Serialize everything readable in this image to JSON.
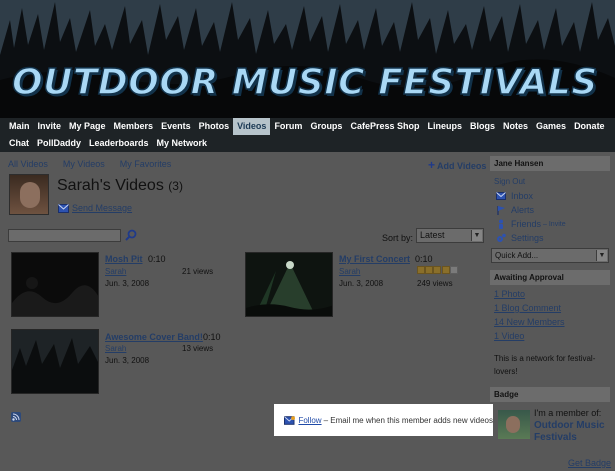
{
  "header": {
    "site_title": "OUTDOOR MUSIC FESTIVALS"
  },
  "nav": {
    "row1": [
      "Main",
      "Invite",
      "My Page",
      "Members",
      "Events",
      "Photos",
      "Videos",
      "Forum",
      "Groups",
      "CafePress Shop",
      "Lineups",
      "Blogs",
      "Notes",
      "Games",
      "Donate"
    ],
    "row2": [
      "Chat",
      "PollDaddy",
      "Leaderboards",
      "My Network"
    ],
    "active": "Videos"
  },
  "tabs": {
    "all": "All Videos",
    "mine": "My Videos",
    "favorites": "My Favorites"
  },
  "add_videos": "Add Videos",
  "page": {
    "title": "Sarah's Videos",
    "count": "(3)",
    "send_message": "Send Message"
  },
  "sort": {
    "label": "Sort by:",
    "value": "Latest"
  },
  "videos": [
    {
      "title": "Mosh Pit",
      "duration": "0:10",
      "author": "Sarah",
      "views": "21 views",
      "date": "Jun. 3, 2008"
    },
    {
      "title": "My First Concert",
      "duration": "0:10",
      "author": "Sarah",
      "views": "249 views",
      "date": "Jun. 3, 2008",
      "rating": 4
    },
    {
      "title": "Awesome Cover Band!",
      "duration": "0:10",
      "author": "Sarah",
      "views": "13 views",
      "date": "Jun. 3, 2008"
    }
  ],
  "follow": {
    "link": "Follow",
    "text": "– Email me when this member adds new videos"
  },
  "sidebar": {
    "user": "Jane Hansen",
    "sign_out": "Sign Out",
    "menu": {
      "inbox": "Inbox",
      "alerts": "Alerts",
      "friends": "Friends",
      "friends_invite": "– Invite",
      "settings": "Settings"
    },
    "quick_add": "Quick Add...",
    "approval": {
      "header": "Awaiting Approval",
      "items": [
        "1 Photo",
        "1 Blog Comment",
        "14 New Members",
        "1 Video"
      ]
    },
    "network_desc": "This is a network for festival-lovers!",
    "badge": {
      "header": "Badge",
      "line1": "I'm a member of:",
      "line2": "Outdoor Music",
      "line3": "Festivals",
      "get": "Get Badge"
    }
  },
  "colors": {
    "nav_bg": "#1e2326",
    "active_tab_bg": "#b6c3ca",
    "link": "#243d66",
    "popup_link": "#1f4aa8"
  }
}
